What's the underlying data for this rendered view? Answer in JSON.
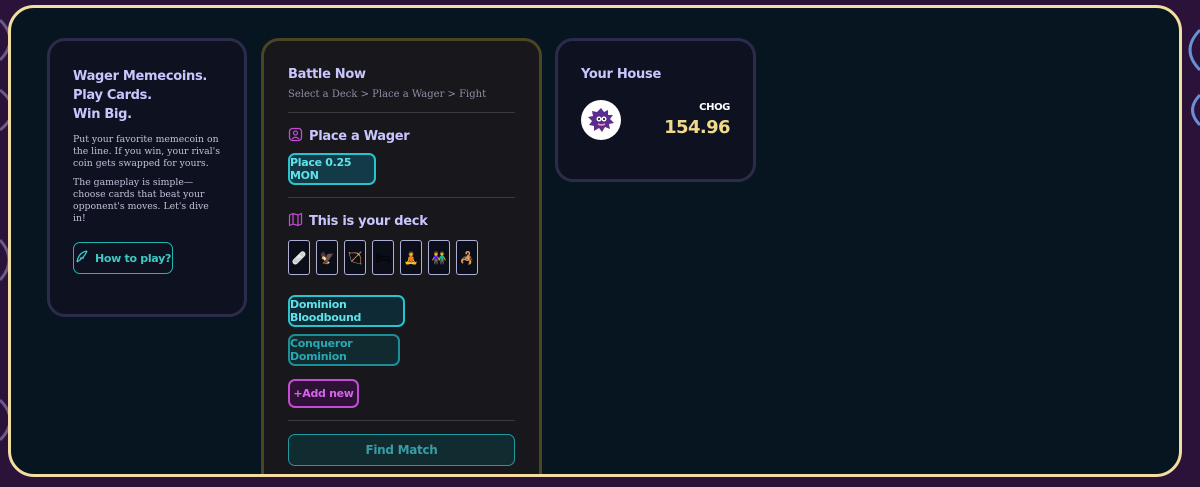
{
  "intro": {
    "headline_line1": "Wager Memecoins.",
    "headline_line2": "Play Cards.",
    "headline_line3": "Win Big.",
    "para1": "Put your favorite memecoin on the line. If you win, your rival's coin gets swapped for yours.",
    "para2": "The gameplay is simple—choose cards that beat your opponent's moves. Let's dive in!",
    "howto_label": "How to play?",
    "howto_icon": "feather-icon"
  },
  "battle": {
    "title": "Battle Now",
    "subtitle": "Select a Deck > Place a Wager > Fight",
    "wager_heading": "Place a Wager",
    "wager_icon": "user-badge-icon",
    "wager_button": "Place 0.25 MON",
    "deck_heading": "This is your deck",
    "deck_icon": "map-icon",
    "deck_cards": [
      "🩹",
      "🦅",
      "🏹",
      "🛏",
      "🧘",
      "👫",
      "🦂"
    ],
    "deck_options": [
      "Dominion Bloodbound",
      "Conqueror Dominion"
    ],
    "add_new": "+Add new",
    "find_match": "Find Match"
  },
  "house": {
    "title": "Your House",
    "coin_label": "CHOG",
    "coin_value": "154.96",
    "avatar_icon": "chog-mascot-icon"
  },
  "colors": {
    "frame_border": "#f3dd9f",
    "accent_cyan": "#29c2cf",
    "accent_purple": "#c54bd6",
    "value_gold": "#f0d98a"
  }
}
